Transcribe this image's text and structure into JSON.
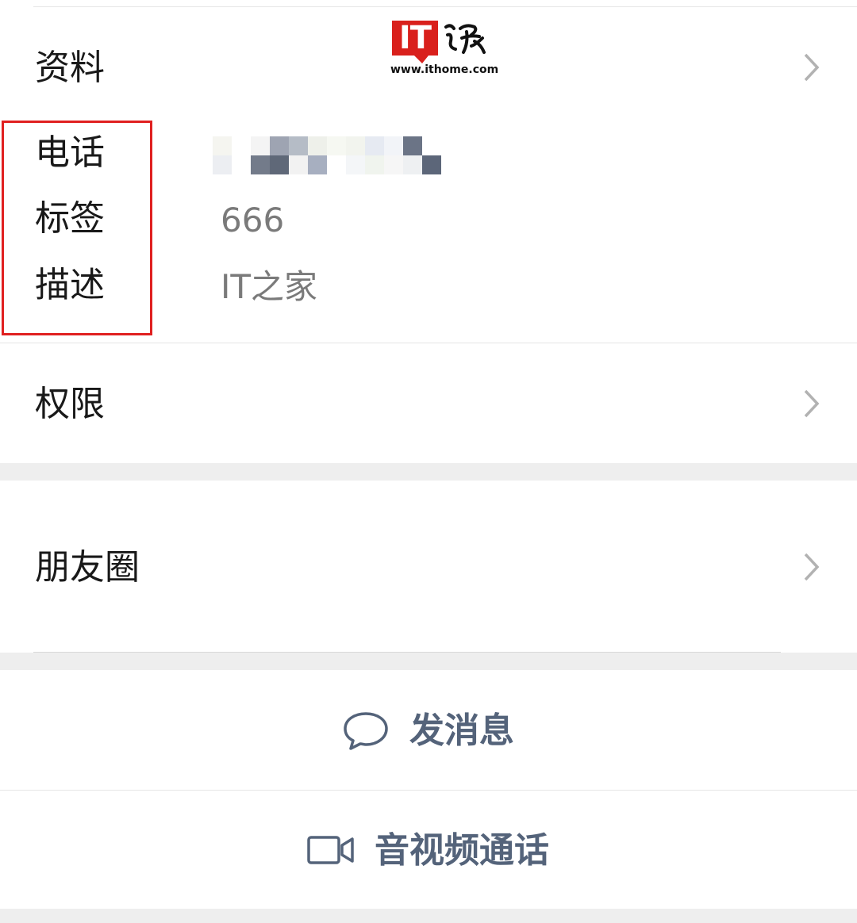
{
  "watermark": {
    "logo_text": "IT",
    "logo_cn": "之家",
    "url": "www.ithome.com"
  },
  "rows": {
    "profile": {
      "label": "资料"
    },
    "phone": {
      "label": "电话",
      "value_redacted": true
    },
    "tag": {
      "label": "标签",
      "value": "666"
    },
    "description": {
      "label": "描述",
      "value": "IT之家"
    },
    "permissions": {
      "label": "权限"
    },
    "moments": {
      "label": "朋友圈"
    }
  },
  "actions": {
    "send_message": {
      "label": "发消息",
      "icon": "chat-bubble-icon"
    },
    "video_call": {
      "label": "音视频通话",
      "icon": "video-camera-icon"
    }
  },
  "colors": {
    "label_text": "#191919",
    "value_text": "#7a7a7a",
    "action_text": "#54637a",
    "highlight_box": "#e02020",
    "separator_band": "#eeeeee",
    "watermark_red": "#d9201c"
  }
}
